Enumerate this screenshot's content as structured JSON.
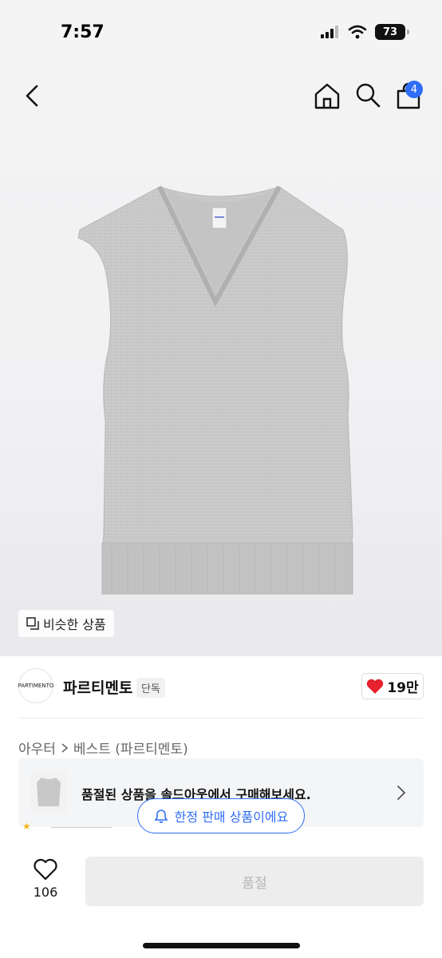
{
  "status_bar": {
    "time": "7:57",
    "battery": "73"
  },
  "nav": {
    "cart_count": "4"
  },
  "product": {
    "similar_button": "비슷한 상품",
    "brand_logo_text": "PARTIMENTO",
    "brand_name": "파르티멘토",
    "brand_tag": "단독",
    "likes": "19만",
    "breadcrumb": [
      "아우터",
      "베스트 (파르티멘토)"
    ],
    "soldout_text": "품절된 상품을 솔드아웃에서 구매해보세요.",
    "limited_text": "한정 판매 상품이에요"
  },
  "bottom_bar": {
    "wish_count": "106",
    "buy_label": "품절"
  },
  "colors": {
    "accent": "#2f6df6",
    "heart": "#e8212f",
    "disabled": "#ededee"
  },
  "icons": [
    "back-icon",
    "home-icon",
    "search-icon",
    "shopping-bag-icon",
    "copy-icon",
    "heart-icon",
    "chevron-right-icon",
    "bell-icon",
    "heart-outline-icon"
  ]
}
